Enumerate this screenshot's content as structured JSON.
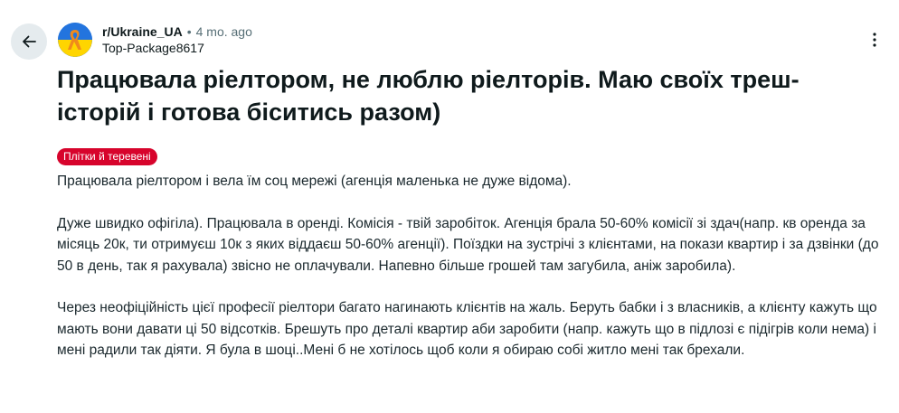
{
  "post": {
    "subreddit": "r/Ukraine_UA",
    "separator": "•",
    "time_ago": "4 mo. ago",
    "author": "Top-Package8617",
    "title": "Працювала ріелтором, не люблю ріелторів. Маю своїх треш-історій і готова біситись разом)",
    "flair": "Плітки й теревені",
    "paragraphs": [
      "Працювала ріелтором і вела їм соц мережі (агенція маленька не дуже відома).",
      "Дуже швидко офігіла). Працювала в оренді. Комісія - твій заробіток. Агенція брала 50-60% комісії зі здач(напр. кв оренда за місяць 20к, ти отримуєш 10к з яких віддаєш 50-60% агенції). Поїздки на зустрічі з клієнтами, на покази квартир і за дзвінки (до 50 в день, так я рахувала) звісно не оплачували. Напевно більше грошей там загубила, аніж заробила).",
      "Через неофіційність цієї професії ріелтори багато нагинають клієнтів на жаль. Беруть бабки і з власників, а клієнту кажуть що мають вони давати ці 50 відсотків. Брешуть про деталі квартир аби заробити (напр. кажуть що в підлозі є підігрів коли нема) і мені радили так діяти. Я була в шоці..Мені б не хотілось щоб коли я обираю собі житло мені так брехали."
    ]
  },
  "colors": {
    "flair_bg": "#d7042c",
    "back_button_bg": "#e5ebee",
    "subreddit_avatar_bg": "#1d70d8",
    "ribbon_yellow": "#f5c400",
    "ribbon_orange": "#f08a1c"
  },
  "icons": {
    "back": "arrow-left-icon",
    "more": "vertical-ellipsis-icon",
    "avatar": "ribbon-avatar-icon"
  }
}
